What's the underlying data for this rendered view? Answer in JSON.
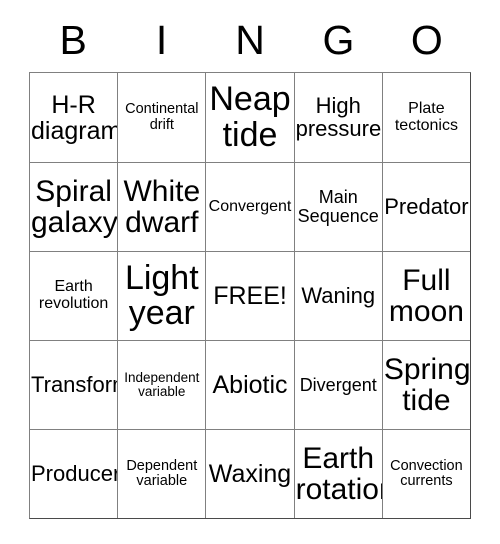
{
  "card": {
    "title": "BINGO",
    "header_letters": [
      "B",
      "I",
      "N",
      "G",
      "O"
    ],
    "free_space_label": "FREE!",
    "colors": {
      "text": "#000000",
      "grid_line": "#808080",
      "background": "#ffffff"
    },
    "rows": [
      [
        {
          "label": "H-R diagram",
          "size": "lg"
        },
        {
          "label": "Continental drift",
          "size": "xxs"
        },
        {
          "label": "Neap tide",
          "size": "xxl"
        },
        {
          "label": "High pressure",
          "size": "md"
        },
        {
          "label": "Plate tectonics",
          "size": "xs"
        }
      ],
      [
        {
          "label": "Spiral galaxy",
          "size": "xl"
        },
        {
          "label": "White dwarf",
          "size": "xl"
        },
        {
          "label": "Convergent",
          "size": "xs"
        },
        {
          "label": "Main Sequence",
          "size": "sm"
        },
        {
          "label": "Predator",
          "size": "md"
        }
      ],
      [
        {
          "label": "Earth revolution",
          "size": "xs"
        },
        {
          "label": "Light year",
          "size": "xxl"
        },
        {
          "label": "FREE!",
          "size": "lg"
        },
        {
          "label": "Waning",
          "size": "md"
        },
        {
          "label": "Full moon",
          "size": "xl"
        }
      ],
      [
        {
          "label": "Transform",
          "size": "md"
        },
        {
          "label": "Independent variable",
          "size": "tiny"
        },
        {
          "label": "Abiotic",
          "size": "lg"
        },
        {
          "label": "Divergent",
          "size": "sm"
        },
        {
          "label": "Spring tide",
          "size": "xl"
        }
      ],
      [
        {
          "label": "Producer",
          "size": "md"
        },
        {
          "label": "Dependent variable",
          "size": "xxs"
        },
        {
          "label": "Waxing",
          "size": "lg"
        },
        {
          "label": "Earth rotation",
          "size": "xl"
        },
        {
          "label": "Convection currents",
          "size": "xxs"
        }
      ]
    ]
  }
}
